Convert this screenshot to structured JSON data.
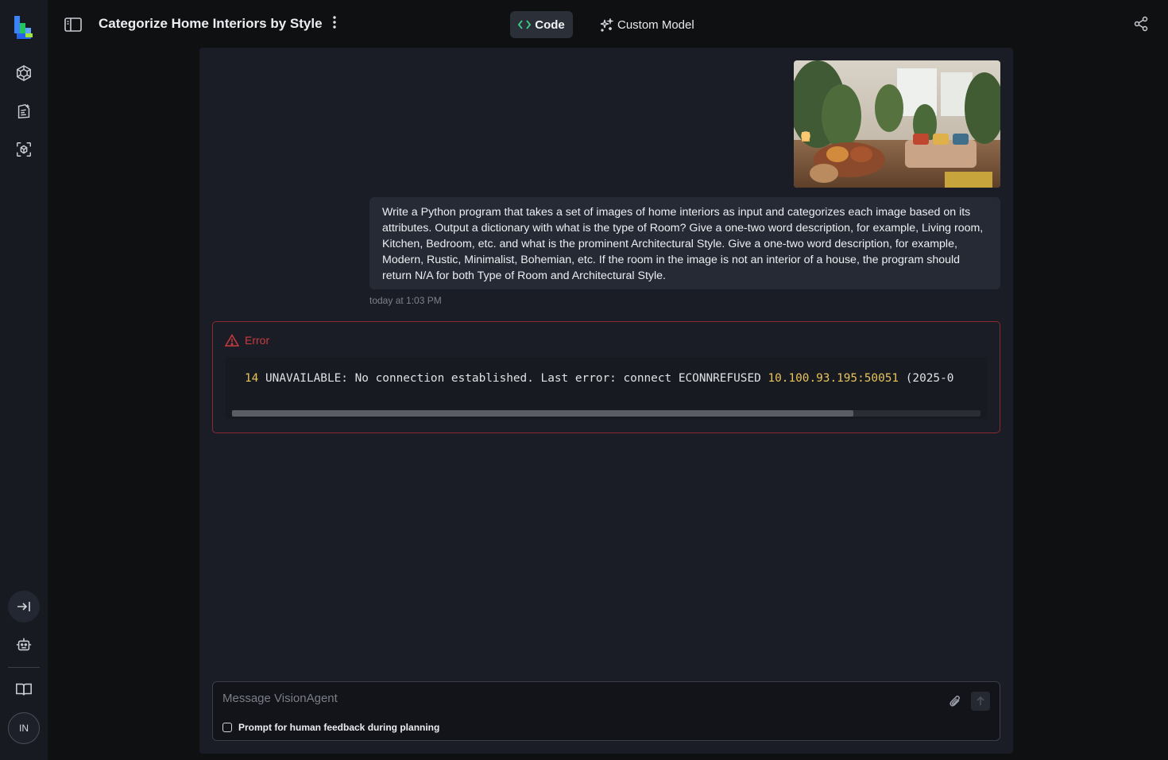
{
  "app": {
    "title": "Categorize Home Interiors by Style"
  },
  "header": {
    "tabs": [
      {
        "label": "Code",
        "active": true,
        "icon": "code-icon"
      },
      {
        "label": "Custom Model",
        "active": false,
        "icon": "sparkle-icon"
      }
    ]
  },
  "sidebar": {
    "items": [
      {
        "icon": "model-hexagon-icon"
      },
      {
        "icon": "agent-document-icon"
      },
      {
        "icon": "scan-cube-icon"
      }
    ],
    "user_initials": "IN"
  },
  "conversation": {
    "user_message": "Write a Python program that takes a set of images of home interiors as input and categorizes each image based on its attributes. Output a dictionary with what is the type of Room? Give a one-two word description, for example, Living room, Kitchen, Bedroom, etc. and what is the prominent Architectural Style. Give a one-two word description, for example, Modern, Rustic, Minimalist, Bohemian, etc. If the room in the image is not an interior of a house, the program should return N/A for both Type of Room and Architectural Style.",
    "timestamp": "today at 1:03 PM",
    "image_alt": "Bohemian living room with plants"
  },
  "error": {
    "title": "Error",
    "code_num": "14",
    "message_text": " UNAVAILABLE: No connection established. Last error: connect ECONNREFUSED ",
    "address": "10.100.93.195:50051",
    "suffix": " (2025-0",
    "scroll_fraction": 0.83
  },
  "composer": {
    "placeholder": "Message VisionAgent",
    "feedback_label": "Prompt for human feedback during planning"
  },
  "colors": {
    "accent_green": "#3fd08a",
    "error_red": "#c93b3f",
    "number_yellow": "#e8c55a"
  }
}
